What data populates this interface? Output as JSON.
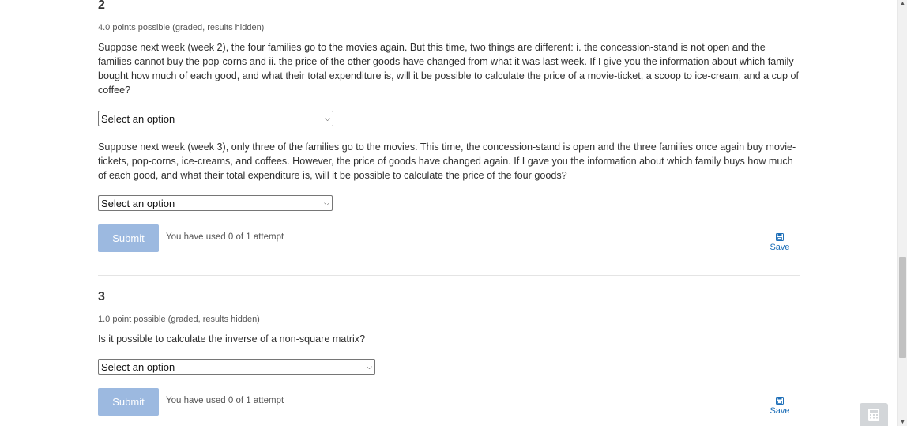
{
  "problem2": {
    "number": "2",
    "points": "4.0 points possible (graded, results hidden)",
    "q1_text": "Suppose next week (week 2), the four families go to the movies again. But this time, two things are different: i. the concession-stand is not open and the families cannot buy the pop-corns and ii. the price of the other goods have changed from what it was last week. If I give you the information about which family bought how much of each good, and what their total expenditure is, will it be possible to calculate the price of a movie-ticket, a scoop to ice-cream, and a cup of coffee?",
    "q1_select": "Select an option",
    "q2_text": "Suppose next week (week 3), only three of the families go to the movies. This time, the concession-stand is open and the three families once again buy movie-tickets, pop-corns, ice-creams, and coffees. However, the price of goods have changed again. If I gave you the information about which family buys how much of each good, and what their total expenditure is, will it be possible to calculate the price of the four goods?",
    "q2_select": "Select an option",
    "submit_label": "Submit",
    "attempts": "You have used 0 of 1 attempt",
    "save_label": "Save"
  },
  "problem3": {
    "number": "3",
    "points": "1.0 point possible (graded, results hidden)",
    "q1_text": "Is it possible to calculate the inverse of a non-square matrix?",
    "q1_select": "Select an option",
    "submit_label": "Submit",
    "attempts": "You have used 0 of 1 attempt",
    "save_label": "Save"
  },
  "icons": {
    "save": "floppy-disk-icon",
    "calculator": "calculator-icon",
    "dropdown": "chevron-down-icon"
  },
  "colors": {
    "submit_bg": "#9cb9e0",
    "link": "#1e6fb8"
  }
}
